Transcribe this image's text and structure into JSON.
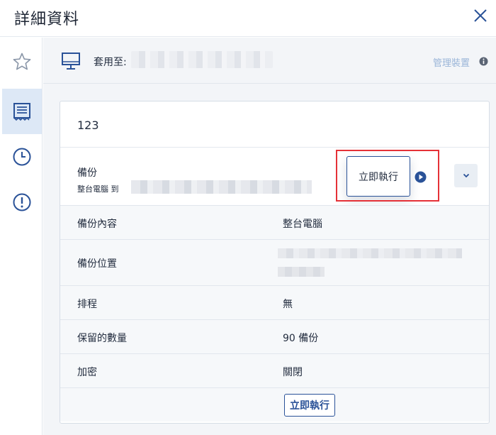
{
  "header": {
    "title": "詳細資料",
    "close_icon": "close-icon"
  },
  "sidebar": {
    "items": [
      {
        "name": "favorite",
        "icon": "star-icon",
        "active": false
      },
      {
        "name": "plan-details",
        "icon": "list-document-icon",
        "active": true
      },
      {
        "name": "history",
        "icon": "clock-icon",
        "active": false
      },
      {
        "name": "alerts",
        "icon": "alert-icon",
        "active": false
      }
    ]
  },
  "apply_to": {
    "label": "套用至:",
    "icon": "monitor-icon",
    "manage_link": "管理裝置",
    "info_icon": "info-icon"
  },
  "plan": {
    "name": "123",
    "backup": {
      "title": "備份",
      "subtitle": "整台電腦 到",
      "run_now_popup": "立即執行",
      "play_icon": "play-icon",
      "expand_icon": "chevron-down-icon"
    },
    "details": [
      {
        "label": "備份內容",
        "value": "整台電腦"
      },
      {
        "label": "備份位置",
        "value": ""
      },
      {
        "label": "排程",
        "value": "無"
      },
      {
        "label": "保留的數量",
        "value": "90 備份"
      },
      {
        "label": "加密",
        "value": "關閉"
      }
    ],
    "run_now_button": "立即執行"
  },
  "colors": {
    "accent": "#2a5298",
    "highlight": "#e53137",
    "active_nav": "#dde8f6",
    "link_muted": "#9ab5d8"
  }
}
